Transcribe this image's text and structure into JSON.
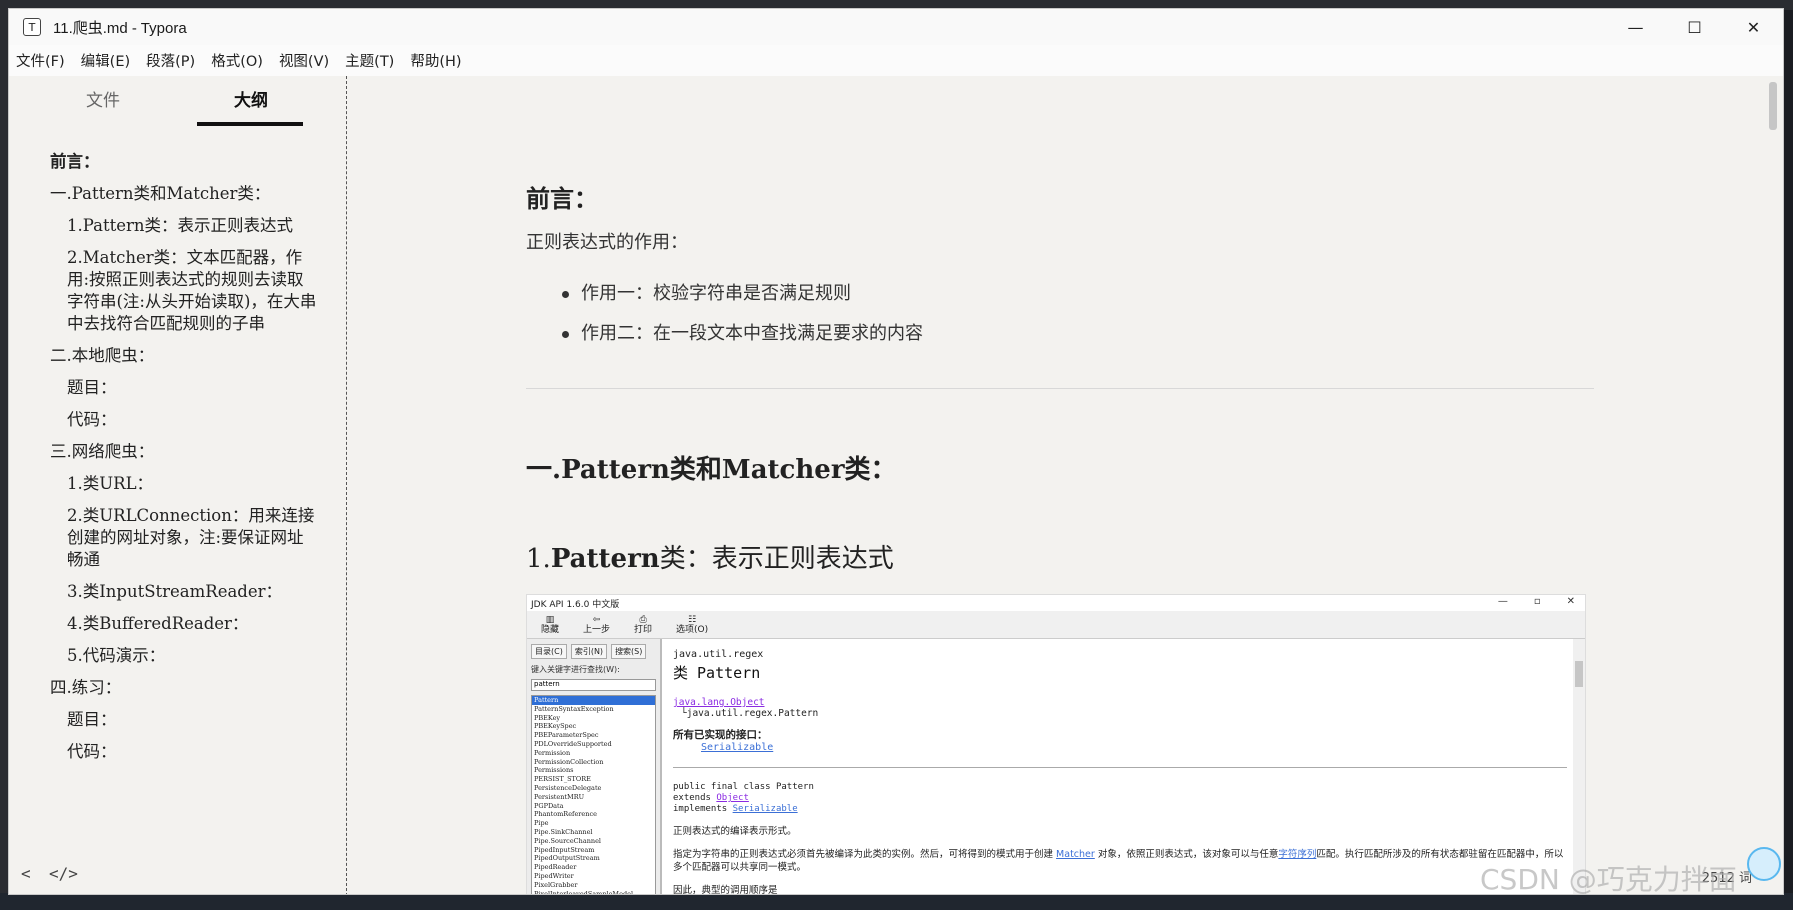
{
  "window": {
    "title": "11.爬虫.md - Typora",
    "app_icon": "T",
    "controls": {
      "minimize": "—",
      "maximize": "☐",
      "close": "✕"
    }
  },
  "menu": [
    "文件(F)",
    "编辑(E)",
    "段落(P)",
    "格式(O)",
    "视图(V)",
    "主题(T)",
    "帮助(H)"
  ],
  "sidebar": {
    "tabs": {
      "files": "文件",
      "outline": "大纲",
      "active": "outline"
    },
    "outline": [
      {
        "level": 1,
        "text": "前言：",
        "bold": true
      },
      {
        "level": 1,
        "text": "一.Pattern类和Matcher类："
      },
      {
        "level": 2,
        "text": "1.Pattern类：表示正则表达式"
      },
      {
        "level": 2,
        "text": "2.Matcher类：文本匹配器，作用:按照正则表达式的规则去读取字符串(注:从头开始读取)，在大串中去找符合匹配规则的子串"
      },
      {
        "level": 1,
        "text": "二.本地爬虫："
      },
      {
        "level": 2,
        "text": "题目："
      },
      {
        "level": 2,
        "text": "代码："
      },
      {
        "level": 1,
        "text": "三.网络爬虫："
      },
      {
        "level": 2,
        "text": "1.类URL："
      },
      {
        "level": 2,
        "text": "2.类URLConnection：用来连接创建的网址对象，注:要保证网址畅通"
      },
      {
        "level": 2,
        "text": "3.类InputStreamReader："
      },
      {
        "level": 2,
        "text": "4.类BufferedReader："
      },
      {
        "level": 2,
        "text": "5.代码演示："
      },
      {
        "level": 1,
        "text": "四.练习："
      },
      {
        "level": 2,
        "text": "题目："
      },
      {
        "level": 2,
        "text": "代码："
      }
    ],
    "footer": {
      "collapse_icon": "<",
      "source_icon": "</>"
    }
  },
  "editor": {
    "preface_heading": "前言：",
    "intro": "正则表达式的作用：",
    "bullets": [
      "作用一：校验字符串是否满足规则",
      "作用二：在一段文本中查找满足要求的内容"
    ],
    "h1_prefix": "一.",
    "h1_text": "Pattern类和Matcher类：",
    "h2_num": "1.",
    "h2_bold": "Pattern",
    "h2_rest": "类：表示正则表达式",
    "status": "2512 词"
  },
  "screenshot": {
    "title": "JDK API 1.6.0 中文版",
    "controls": [
      "—",
      "▫",
      "✕"
    ],
    "toolbar": [
      {
        "icon": "▥",
        "label": "隐藏"
      },
      {
        "icon": "⇦",
        "label": "上一步"
      },
      {
        "icon": "⎙",
        "label": "打印"
      },
      {
        "icon": "☷",
        "label": "选项(O)"
      }
    ],
    "tabs": [
      "目录(C)",
      "索引(N)",
      "搜索(S)"
    ],
    "search_label": "键入关键字进行查找(W):",
    "search_value": "pattern",
    "list_items": [
      "Pattern",
      "PatternSyntaxException",
      "PBEKey",
      "PBEKeySpec",
      "PBEParameterSpec",
      "PDLOverrideSupported",
      "Permission",
      "PermissionCollection",
      "Permissions",
      "PERSIST_STORE",
      "PersistenceDelegate",
      "PersistentMRU",
      "PGPData",
      "PhantomReference",
      "Pipe",
      "Pipe.SinkChannel",
      "Pipe.SourceChannel",
      "PipedInputStream",
      "PipedOutputStream",
      "PipedReader",
      "PipedWriter",
      "PixelGrabber",
      "PixelInterleavedSampleModel"
    ],
    "selected_index": 0,
    "doc": {
      "package": "java.util.regex",
      "class_title": "类 Pattern",
      "super_link": "java.lang.Object",
      "tree_child": "└java.util.regex.Pattern",
      "impl_heading": "所有已实现的接口：",
      "impl_link": "Serializable",
      "decl_line1": "public final class Pattern",
      "decl_extends": "extends",
      "decl_extends_link": "Object",
      "decl_implements": "implements",
      "decl_implements_link": "Serializable",
      "desc1": "正则表达式的编译表示形式。",
      "desc2_a": "指定为字符串的正则表达式必须首先被编译为此类的实例。然后，可将得到的模式用于创建",
      "desc2_link": "Matcher",
      "desc2_b": "对象，依照正则表达式，该对象可以与任意",
      "desc2_link2": "字符序列",
      "desc2_c": "匹配。执行匹配所涉及的所有状态都驻留在匹配器中，所以多个匹配器可以共享同一模式。",
      "desc3": "因此，典型的调用顺序是"
    }
  },
  "watermark": "CSDN @巧克力拌面"
}
